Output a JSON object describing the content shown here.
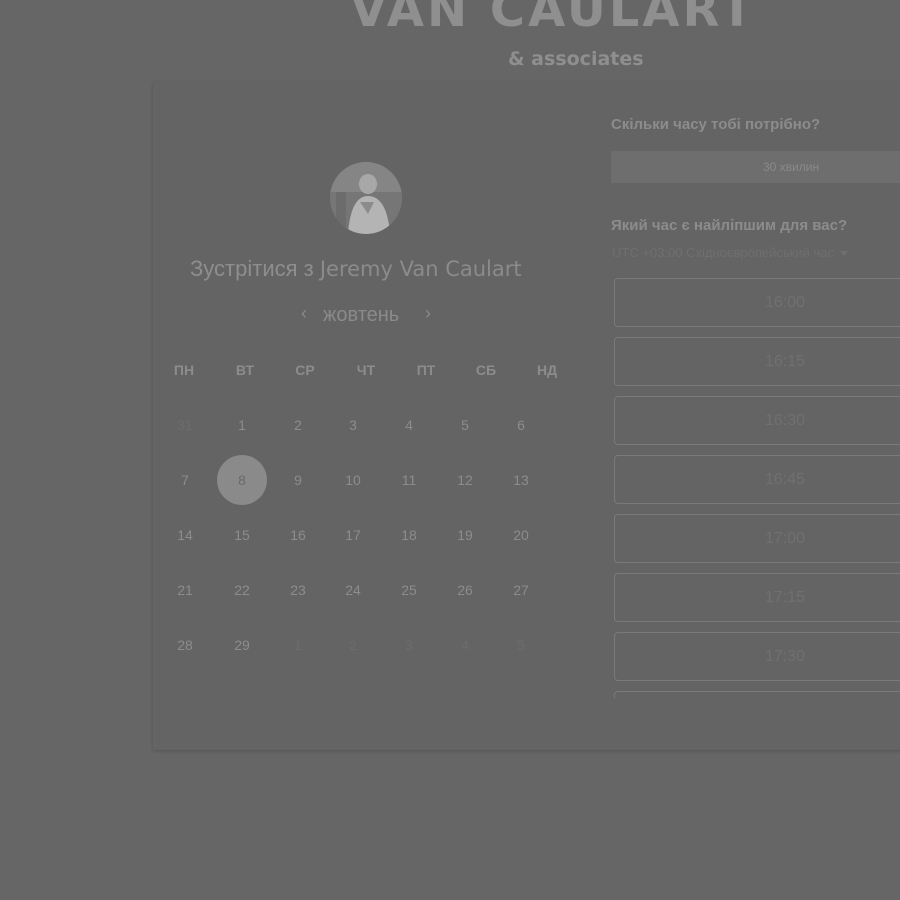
{
  "brand": {
    "name": "VAN CAULART",
    "sub": "& associates"
  },
  "host": {
    "prefix": "Зустрітися з",
    "name": "Jeremy Van Caulart"
  },
  "calendar": {
    "month": "жовтень",
    "weekdays": [
      "ПН",
      "ВТ",
      "СР",
      "ЧТ",
      "ПТ",
      "СБ",
      "НД"
    ],
    "weeks": [
      [
        {
          "d": "31",
          "muted": true
        },
        {
          "d": "1"
        },
        {
          "d": "2"
        },
        {
          "d": "3"
        },
        {
          "d": "4"
        },
        {
          "d": "5"
        },
        {
          "d": "6"
        }
      ],
      [
        {
          "d": "7"
        },
        {
          "d": "8",
          "selected": true
        },
        {
          "d": "9"
        },
        {
          "d": "10"
        },
        {
          "d": "11"
        },
        {
          "d": "12"
        },
        {
          "d": "13"
        }
      ],
      [
        {
          "d": "14"
        },
        {
          "d": "15"
        },
        {
          "d": "16"
        },
        {
          "d": "17"
        },
        {
          "d": "18"
        },
        {
          "d": "19"
        },
        {
          "d": "20"
        }
      ],
      [
        {
          "d": "21"
        },
        {
          "d": "22"
        },
        {
          "d": "23"
        },
        {
          "d": "24"
        },
        {
          "d": "25"
        },
        {
          "d": "26"
        },
        {
          "d": "27"
        }
      ],
      [
        {
          "d": "28"
        },
        {
          "d": "29"
        },
        {
          "d": "1",
          "muted": true
        },
        {
          "d": "2",
          "muted": true
        },
        {
          "d": "3",
          "muted": true
        },
        {
          "d": "4",
          "muted": true
        },
        {
          "d": "5",
          "muted": true
        }
      ]
    ],
    "prev_icon": "chevron-left-icon",
    "next_icon": "chevron-right-icon"
  },
  "booking": {
    "duration_question": "Скільки часу тобі потрібно?",
    "duration_value": "30 хвилин",
    "time_question": "Який час є найліпшим для вас?",
    "timezone": "UTC +03:00 Східноєвропейський час",
    "slots": [
      "16:00",
      "16:15",
      "16:30",
      "16:45",
      "17:00",
      "17:15",
      "17:30"
    ]
  }
}
